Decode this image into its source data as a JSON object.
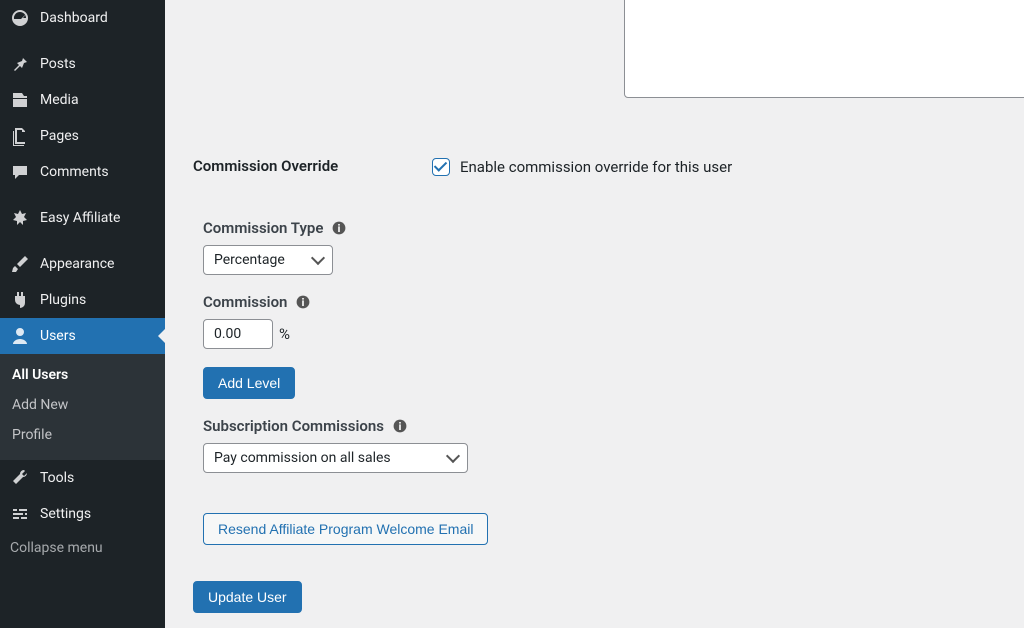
{
  "sidebar": {
    "items": [
      {
        "label": "Dashboard",
        "icon": "dashboard"
      },
      {
        "label": "Posts",
        "icon": "pin"
      },
      {
        "label": "Media",
        "icon": "media"
      },
      {
        "label": "Pages",
        "icon": "pages"
      },
      {
        "label": "Comments",
        "icon": "comment"
      },
      {
        "label": "Easy Affiliate",
        "icon": "affiliate"
      },
      {
        "label": "Appearance",
        "icon": "brush"
      },
      {
        "label": "Plugins",
        "icon": "plug"
      },
      {
        "label": "Users",
        "icon": "user",
        "active": true,
        "subitems": [
          {
            "label": "All Users",
            "current": true
          },
          {
            "label": "Add New"
          },
          {
            "label": "Profile"
          }
        ]
      },
      {
        "label": "Tools",
        "icon": "wrench"
      },
      {
        "label": "Settings",
        "icon": "sliders"
      }
    ],
    "collapse_label": "Collapse menu"
  },
  "form": {
    "textarea_value": "",
    "commission_override": {
      "label": "Commission Override",
      "checkbox_label": "Enable commission override for this user",
      "enabled": true
    },
    "commission_type": {
      "label": "Commission Type",
      "value": "Percentage"
    },
    "commission": {
      "label": "Commission",
      "value": "0.00",
      "unit": "%"
    },
    "add_level_label": "Add Level",
    "subscription_commissions": {
      "label": "Subscription Commissions",
      "value": "Pay commission on all sales"
    },
    "resend_label": "Resend Affiliate Program Welcome Email",
    "submit_label": "Update User"
  }
}
